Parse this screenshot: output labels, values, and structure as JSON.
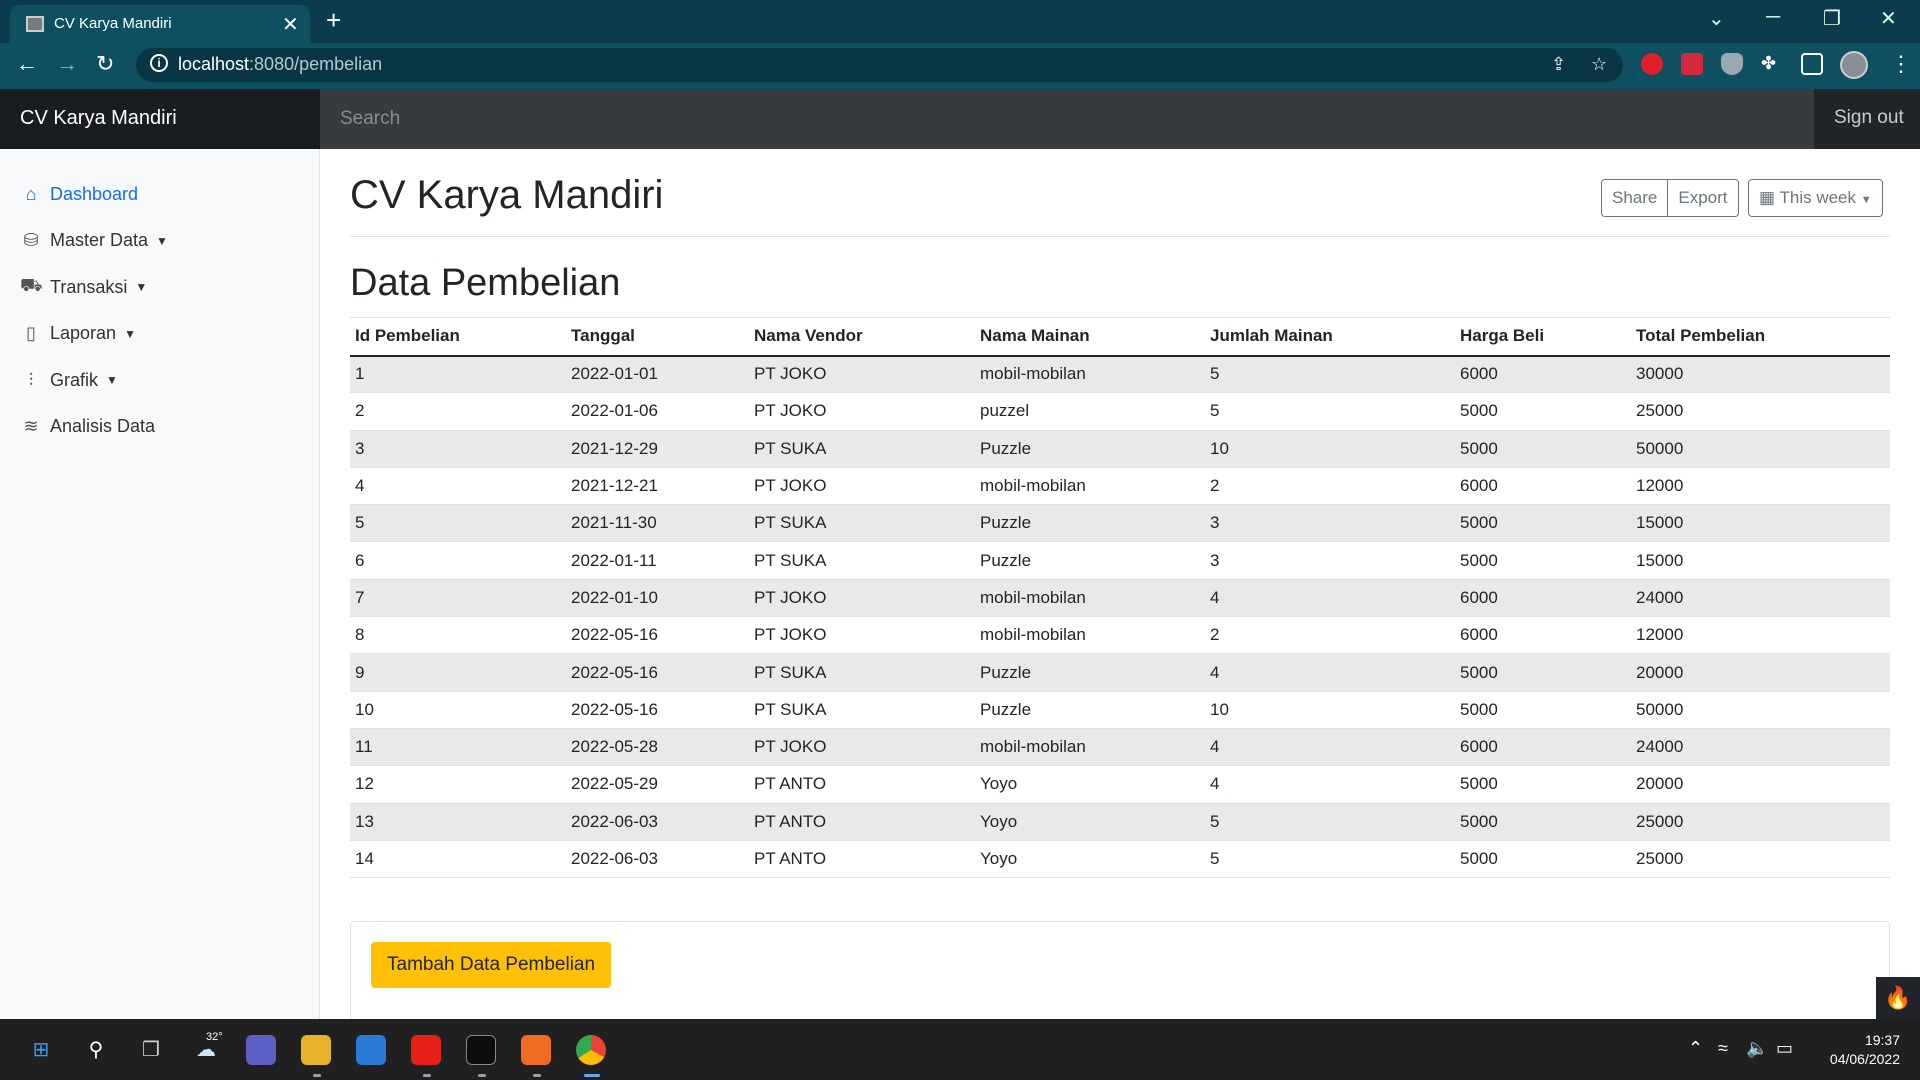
{
  "browser": {
    "tab_title": "CV Karya Mandiri",
    "url_host": "localhost",
    "url_rest": ":8080/pembelian"
  },
  "nav": {
    "brand": "CV Karya Mandiri",
    "search_placeholder": "Search",
    "signout": "Sign out"
  },
  "sidebar": {
    "items": [
      {
        "label": "Dashboard",
        "icon": "home-icon",
        "active": true
      },
      {
        "label": "Master Data",
        "icon": "database-icon",
        "dropdown": true
      },
      {
        "label": "Transaksi",
        "icon": "cart-icon",
        "dropdown": true
      },
      {
        "label": "Laporan",
        "icon": "clipboard-icon",
        "dropdown": true
      },
      {
        "label": "Grafik",
        "icon": "bar-chart-icon",
        "dropdown": true
      },
      {
        "label": "Analisis Data",
        "icon": "layers-icon"
      }
    ]
  },
  "header": {
    "title": "CV Karya Mandiri",
    "share": "Share",
    "export": "Export",
    "period": "This week"
  },
  "section": {
    "title": "Data Pembelian"
  },
  "table": {
    "columns": [
      "Id Pembelian",
      "Tanggal",
      "Nama Vendor",
      "Nama Mainan",
      "Jumlah Mainan",
      "Harga Beli",
      "Total Pembelian"
    ],
    "rows": [
      [
        "1",
        "2022-01-01",
        "PT JOKO",
        "mobil-mobilan",
        "5",
        "6000",
        "30000"
      ],
      [
        "2",
        "2022-01-06",
        "PT JOKO",
        "puzzel",
        "5",
        "5000",
        "25000"
      ],
      [
        "3",
        "2021-12-29",
        "PT SUKA",
        "Puzzle",
        "10",
        "5000",
        "50000"
      ],
      [
        "4",
        "2021-12-21",
        "PT JOKO",
        "mobil-mobilan",
        "2",
        "6000",
        "12000"
      ],
      [
        "5",
        "2021-11-30",
        "PT SUKA",
        "Puzzle",
        "3",
        "5000",
        "15000"
      ],
      [
        "6",
        "2022-01-11",
        "PT SUKA",
        "Puzzle",
        "3",
        "5000",
        "15000"
      ],
      [
        "7",
        "2022-01-10",
        "PT JOKO",
        "mobil-mobilan",
        "4",
        "6000",
        "24000"
      ],
      [
        "8",
        "2022-05-16",
        "PT JOKO",
        "mobil-mobilan",
        "2",
        "6000",
        "12000"
      ],
      [
        "9",
        "2022-05-16",
        "PT SUKA",
        "Puzzle",
        "4",
        "5000",
        "20000"
      ],
      [
        "10",
        "2022-05-16",
        "PT SUKA",
        "Puzzle",
        "10",
        "5000",
        "50000"
      ],
      [
        "11",
        "2022-05-28",
        "PT JOKO",
        "mobil-mobilan",
        "4",
        "6000",
        "24000"
      ],
      [
        "12",
        "2022-05-29",
        "PT ANTO",
        "Yoyo",
        "4",
        "5000",
        "20000"
      ],
      [
        "13",
        "2022-06-03",
        "PT ANTO",
        "Yoyo",
        "5",
        "5000",
        "25000"
      ],
      [
        "14",
        "2022-06-03",
        "PT ANTO",
        "Yoyo",
        "5",
        "5000",
        "25000"
      ]
    ]
  },
  "actions": {
    "add_label": "Tambah Data Pembelian"
  },
  "taskbar": {
    "temperature": "32°",
    "time": "19:37",
    "date": "04/06/2022"
  },
  "colors": {
    "accent": "#0d6efd",
    "add_button": "#ffc107",
    "navbar": "#212529",
    "browser_frame": "#0e4f62"
  }
}
